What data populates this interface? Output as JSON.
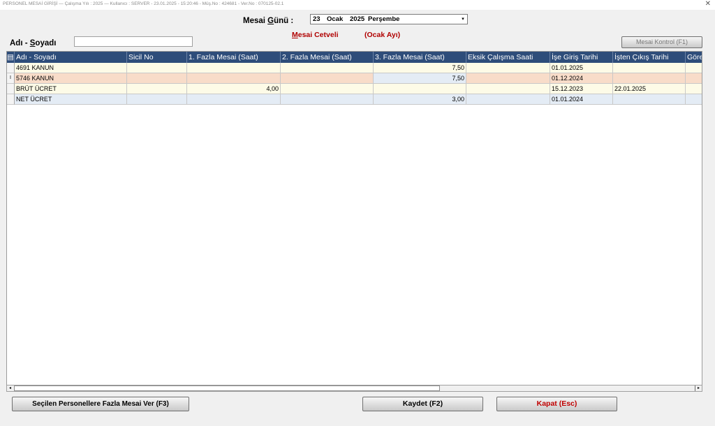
{
  "window": {
    "title": "PERSONEL MESAİ GİRİŞİ  —  Çalışma Yılı : 2025  —  Kullanıcı : SERVER - 23.01.2025 - 15:20:46 - Müş.No : 424681 - Ver.No : 070125-02.1",
    "close_glyph": "✕"
  },
  "filters": {
    "date_label_prefix": "Mesai ",
    "date_label_underlined": "G",
    "date_label_suffix": "ünü :",
    "date_day": "23",
    "date_month": "Ocak",
    "date_year": "2025",
    "date_weekday": "Perşembe",
    "dropdown_glyph": "▾",
    "name_label_prefix": "Adı - ",
    "name_label_underlined": "S",
    "name_label_suffix": "oyadı",
    "name_value": ""
  },
  "headings": {
    "cetvel_underlined": "M",
    "cetvel_rest": "esai Cetveli",
    "month": "(Ocak Ayı)"
  },
  "buttons": {
    "mesai_kontrol": "Mesai Kontrol (F1)",
    "fazla_mesai_ver": "Seçilen Personellere Fazla Mesai Ver (F3)",
    "kaydet": "Kaydet (F2)",
    "kapat": "Kapat (Esc)"
  },
  "table": {
    "columns": [
      "Adı - Soyadı",
      "Sicil No",
      "1. Fazla Mesai (Saat)",
      "2. Fazla Mesai (Saat)",
      "3. Fazla Mesai (Saat)",
      "Eksik Çalışma Saati",
      "İşe Giriş Tarihi",
      "İşten Çıkış Tarihi",
      "Göre"
    ],
    "rows": [
      {
        "indicator": "",
        "cells": [
          "4691 KANUN",
          "",
          "",
          "",
          "7,50",
          "",
          "01.01.2025",
          "",
          ""
        ]
      },
      {
        "indicator": "I",
        "cells": [
          "5746 KANUN",
          "",
          "",
          "",
          "7,50",
          "",
          "01.12.2024",
          "",
          ""
        ]
      },
      {
        "indicator": "",
        "cells": [
          "BRÜT ÜCRET",
          "",
          "4,00",
          "",
          "",
          "",
          "15.12.2023",
          "22.01.2025",
          ""
        ]
      },
      {
        "indicator": "",
        "cells": [
          "NET ÜCRET",
          "",
          "",
          "",
          "3,00",
          "",
          "01.01.2024",
          "",
          ""
        ]
      }
    ]
  },
  "scrollbar": {
    "left_arrow": "◂",
    "right_arrow": "▸"
  },
  "colors": {
    "header_bg": "#2e4d7a",
    "accent_red": "#b00000",
    "kapat_text": "#c00000"
  }
}
